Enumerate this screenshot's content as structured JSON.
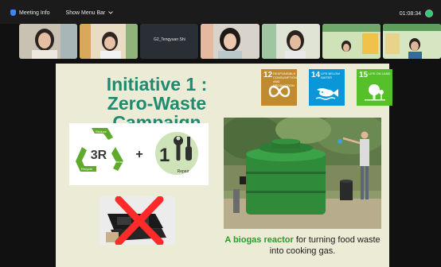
{
  "window": {
    "meeting_info_label": "Meeting Info",
    "show_menu_label": "Show Menu Bar",
    "timer": "01:08:34",
    "shield_color": "#3a86ff",
    "rec_color": "#2ecc71"
  },
  "participants": [
    {
      "id": "p1",
      "name": ""
    },
    {
      "id": "p2",
      "name": ""
    },
    {
      "id": "p3",
      "name": "G2_Tengyuan Shi"
    },
    {
      "id": "p4",
      "name": ""
    },
    {
      "id": "p5",
      "name": ""
    },
    {
      "id": "p6",
      "name": ""
    },
    {
      "id": "p7",
      "name": ""
    }
  ],
  "slide": {
    "title_line1": "Initiative 1 :",
    "title_line2": "Zero-Waste Campaign",
    "title_color": "#1e8a70",
    "sdg": [
      {
        "num": "12",
        "label": "RESPONSIBLE CONSUMPTION AND PRODUCTION",
        "color": "#bf8b2e",
        "icon": "infinity-icon"
      },
      {
        "num": "14",
        "label": "LIFE BELOW WATER",
        "color": "#0a97d9",
        "icon": "fish-icon"
      },
      {
        "num": "15",
        "label": "LIFE ON LAND",
        "color": "#56c02b",
        "icon": "tree-icon"
      }
    ],
    "three_r": {
      "label": "3R",
      "reduce": "Reduce",
      "reuse": "Reuse",
      "recycle": "Recycle",
      "plus": "+",
      "one": "1",
      "repair": "Repair"
    },
    "caption": {
      "highlight": "A biogas reactor",
      "rest": " for turning food waste into cooking gas."
    }
  }
}
